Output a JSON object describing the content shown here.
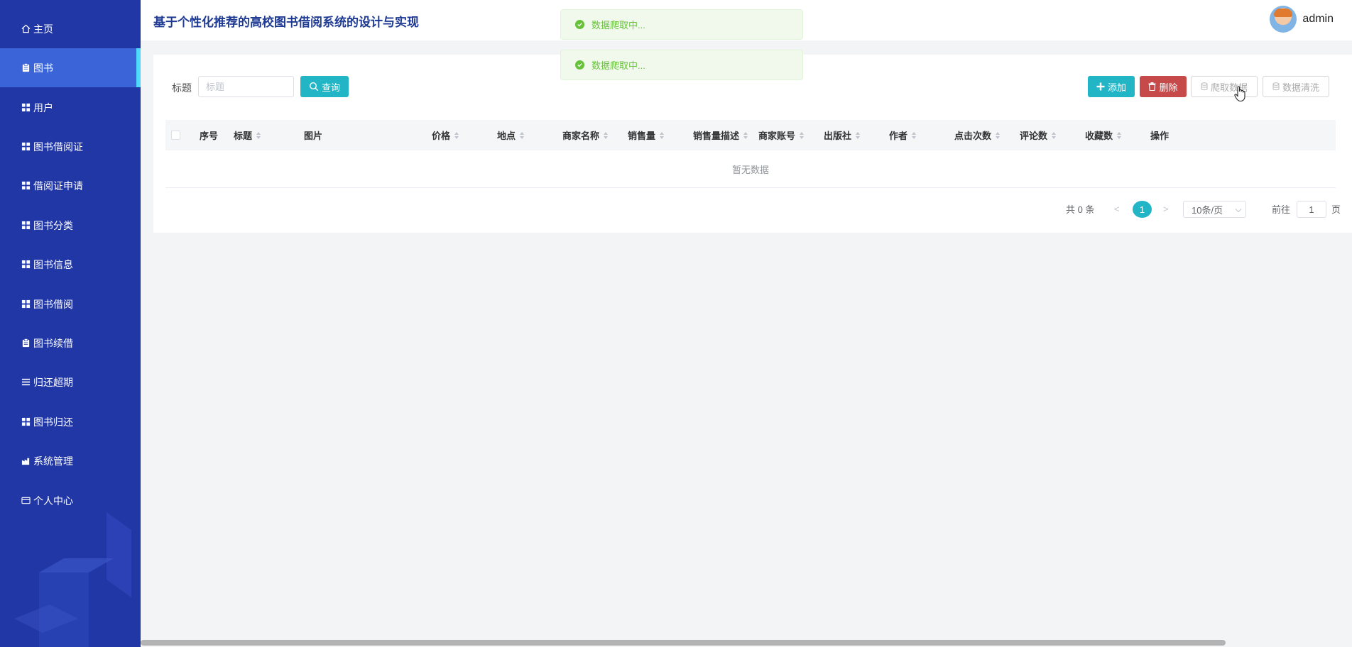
{
  "app": {
    "title": "基于个性化推荐的高校图书借阅系统的设计与实现"
  },
  "user": {
    "name": "admin"
  },
  "sidebar": {
    "items": [
      {
        "label": "主页",
        "icon": "home-icon"
      },
      {
        "label": "图书",
        "icon": "clipboard-icon",
        "active": true
      },
      {
        "label": "用户",
        "icon": "grid-icon"
      },
      {
        "label": "图书借阅证",
        "icon": "grid-icon"
      },
      {
        "label": "借阅证申请",
        "icon": "grid-icon"
      },
      {
        "label": "图书分类",
        "icon": "grid-icon"
      },
      {
        "label": "图书信息",
        "icon": "grid-icon"
      },
      {
        "label": "图书借阅",
        "icon": "grid-icon"
      },
      {
        "label": "图书续借",
        "icon": "clipboard-icon"
      },
      {
        "label": "归还超期",
        "icon": "list-icon"
      },
      {
        "label": "图书归还",
        "icon": "grid-icon"
      },
      {
        "label": "系统管理",
        "icon": "settings-icon"
      },
      {
        "label": "个人中心",
        "icon": "card-icon"
      }
    ]
  },
  "toasts": [
    {
      "text": "数据爬取中..."
    },
    {
      "text": "数据爬取中..."
    }
  ],
  "search": {
    "label": "标题",
    "placeholder": "标题",
    "value": "",
    "button": "查询"
  },
  "toolbar": {
    "add": "添加",
    "delete": "删除",
    "crawl": "爬取数据",
    "clean": "数据清洗"
  },
  "table": {
    "columns": [
      "序号",
      "标题",
      "图片",
      "价格",
      "地点",
      "商家名称",
      "销售量",
      "销售量描述",
      "商家账号",
      "出版社",
      "作者",
      "点击次数",
      "评论数",
      "收藏数",
      "操作"
    ],
    "rows": [],
    "empty_text": "暂无数据"
  },
  "pagination": {
    "total_text": "共 0 条",
    "prev": "<",
    "current_page": "1",
    "next": ">",
    "page_size": "10条/页",
    "goto_label": "前往",
    "goto_value": "1",
    "page_suffix": "页"
  },
  "colors": {
    "sidebar": "#2137a6",
    "active": "#3a64d8",
    "accent": "#22b5c6",
    "danger": "#c64a4a",
    "success": "#67c23a"
  }
}
